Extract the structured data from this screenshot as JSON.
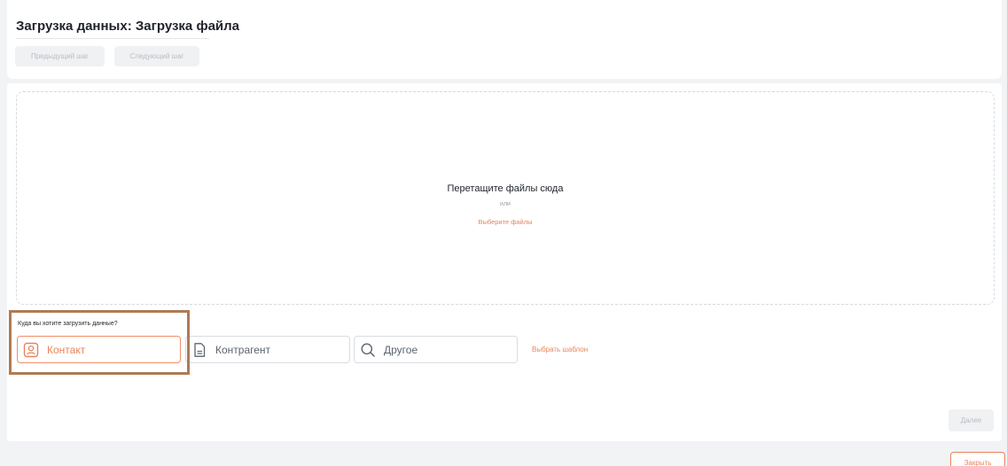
{
  "header": {
    "title": "Загрузка данных: Загрузка файла",
    "prev_step_label": "Предыдущий шаг",
    "next_step_label": "Следующий шаг"
  },
  "dropzone": {
    "title": "Перетащите файлы сюда",
    "or_text": "или",
    "choose_files_label": "Выберите файлы"
  },
  "destination": {
    "question": "Куда вы хотите загрузить данные?",
    "options": [
      {
        "label": "Контакт",
        "icon": "contact-icon",
        "selected": true
      },
      {
        "label": "Контрагент",
        "icon": "document-icon",
        "selected": false
      },
      {
        "label": "Другое",
        "icon": "search-icon",
        "selected": false
      }
    ],
    "template_link": "Выбрать шаблон"
  },
  "footer": {
    "next_label": "Далее",
    "close_label": "Закрыть"
  },
  "colors": {
    "accent": "#e8845a",
    "highlight": "#b07a55",
    "disabled_bg": "#f0f1f3",
    "disabled_text": "#b7bcc4"
  }
}
